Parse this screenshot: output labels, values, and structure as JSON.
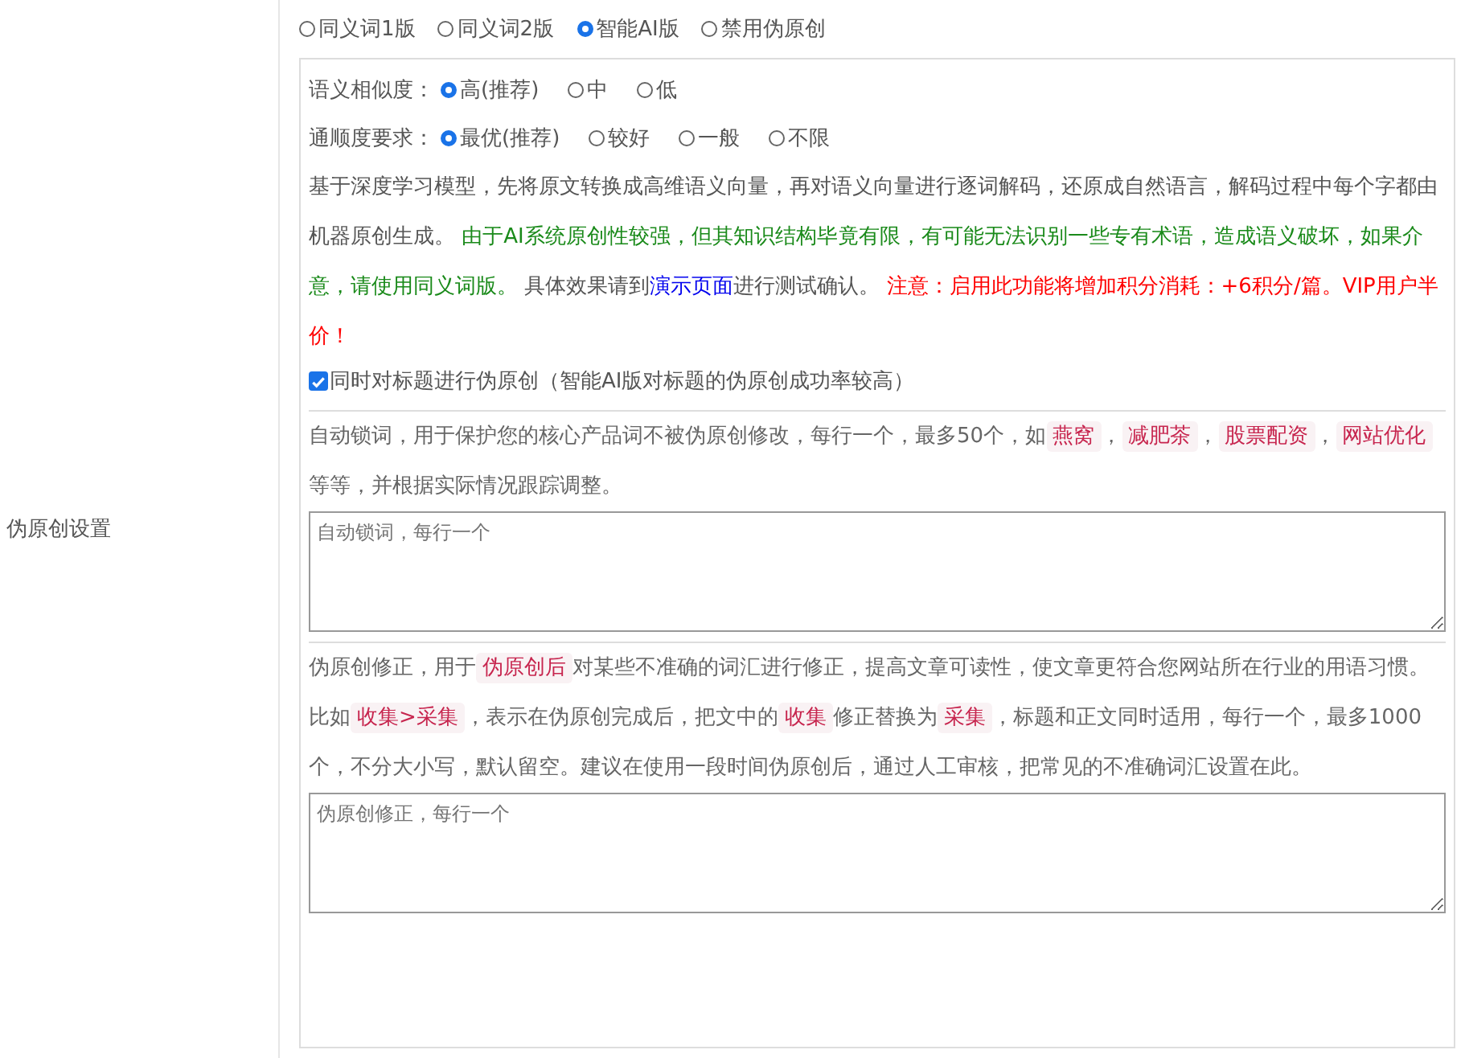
{
  "section_label": "伪原创设置",
  "modes": [
    {
      "label": "同义词1版",
      "selected": false
    },
    {
      "label": "同义词2版",
      "selected": false
    },
    {
      "label": "智能AI版",
      "selected": true
    },
    {
      "label": "禁用伪原创",
      "selected": false
    }
  ],
  "similarity": {
    "label": "语义相似度：",
    "options": [
      {
        "label": "高(推荐)",
        "selected": true
      },
      {
        "label": "中",
        "selected": false
      },
      {
        "label": "低",
        "selected": false
      }
    ]
  },
  "fluency": {
    "label": "通顺度要求：",
    "options": [
      {
        "label": "最优(推荐)",
        "selected": true
      },
      {
        "label": "较好",
        "selected": false
      },
      {
        "label": "一般",
        "selected": false
      },
      {
        "label": "不限",
        "selected": false
      }
    ]
  },
  "ai_description": [
    {
      "kind": "plain",
      "text": "基于深度学习模型，先将原文转换成高维语义向量，再对语义向量进行逐词解码，还原成自然语言，解码过程中每个字都由机器原创生成。 "
    },
    {
      "kind": "warning",
      "text": "由于AI系统原创性较强，但其知识结构毕竟有限，有可能无法识别一些专有术语，造成语义破坏，如果介意，请使用同义词版。"
    },
    {
      "kind": "plain",
      "text": " 具体效果请到"
    },
    {
      "kind": "link",
      "text": "演示页面"
    },
    {
      "kind": "plain",
      "text": "进行测试确认。 "
    },
    {
      "kind": "alert",
      "text": "注意：启用此功能将增加积分消耗：+6积分/篇。VIP用户半价！"
    }
  ],
  "title_option": {
    "label": "同时对标题进行伪原创（智能AI版对标题的伪原创成功率较高）",
    "checked": true
  },
  "lock_words": {
    "description": [
      {
        "kind": "plain",
        "text": "自动锁词，用于保护您的核心产品词不被伪原创修改，每行一个，最多50个，如"
      },
      {
        "kind": "tag",
        "text": "燕窝"
      },
      {
        "kind": "plain",
        "text": "，"
      },
      {
        "kind": "tag",
        "text": "减肥茶"
      },
      {
        "kind": "plain",
        "text": "，"
      },
      {
        "kind": "tag",
        "text": "股票配资"
      },
      {
        "kind": "plain",
        "text": "，"
      },
      {
        "kind": "tag",
        "text": "网站优化"
      },
      {
        "kind": "plain",
        "text": " 等等，并根据实际情况跟踪调整。"
      }
    ],
    "placeholder": "自动锁词，每行一个"
  },
  "corrections": {
    "description": [
      {
        "kind": "plain",
        "text": "伪原创修正，用于"
      },
      {
        "kind": "tag",
        "text": "伪原创后"
      },
      {
        "kind": "plain",
        "text": "对某些不准确的词汇进行修正，提高文章可读性，使文章更符合您网站所在行业的用语习惯。比如"
      },
      {
        "kind": "tag",
        "text": "收集>采集"
      },
      {
        "kind": "plain",
        "text": "，表示在伪原创完成后，把文中的"
      },
      {
        "kind": "tag",
        "text": "收集"
      },
      {
        "kind": "plain",
        "text": "修正替换为"
      },
      {
        "kind": "tag",
        "text": "采集"
      },
      {
        "kind": "plain",
        "text": "，标题和正文同时适用，每行一个，最多1000个，不分大小写，默认留空。建议在使用一段时间伪原创后，通过人工审核，把常见的不准确词汇设置在此。"
      }
    ],
    "placeholder": "伪原创修正，每行一个"
  }
}
